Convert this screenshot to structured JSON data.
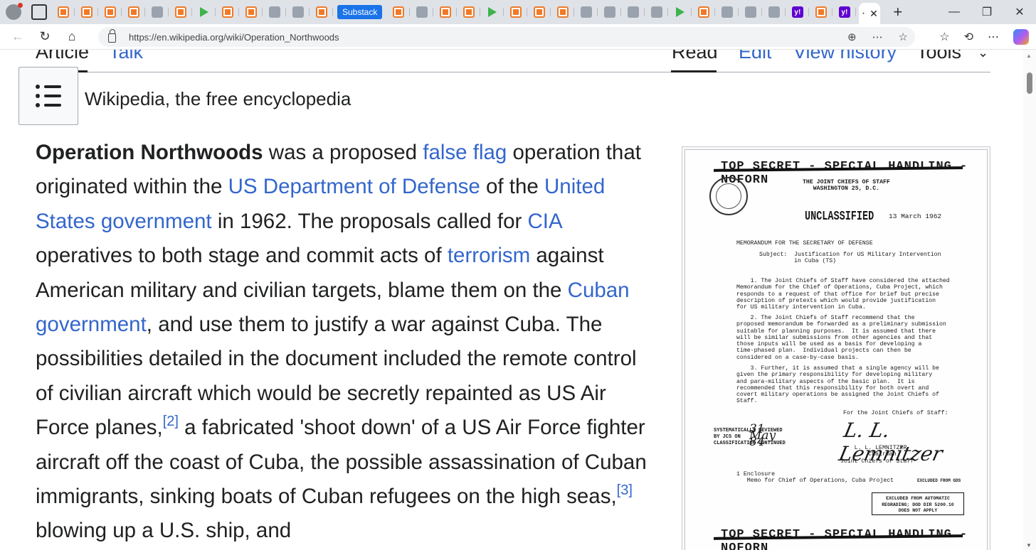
{
  "browser": {
    "active_tab_title": "·",
    "substack_tab_label": "Substack",
    "url": "https://en.wikipedia.org/wiki/Operation_Northwoods",
    "favicon_count": 34
  },
  "wiki": {
    "tabs": {
      "article": "Article",
      "talk": "Talk",
      "read": "Read",
      "edit": "Edit",
      "history": "View history",
      "tools": "Tools"
    },
    "tagline": "Wikipedia, the free encyclopedia",
    "lead": {
      "title": "Operation Northwoods",
      "s1": " was a proposed ",
      "l_false_flag": "false flag",
      "s2": " operation that originated within the ",
      "l_dod": "US Department of Defense",
      "s3": " of the ",
      "l_usgov": "United States government",
      "s4": " in 1962. The proposals called for ",
      "l_cia": "CIA",
      "s5": " operatives to both stage and commit acts of ",
      "l_terrorism": "terrorism",
      "s6": " against American military and civilian targets, blame them on the ",
      "l_cuban_gov": "Cuban government",
      "s7": ", and use them to justify a war against Cuba. The possibilities detailed in the document included the remote control of civilian aircraft which would be secretly repainted as US Air Force planes,",
      "ref2": "[2]",
      "s8": " a fabricated 'shoot down' of a US Air Force fighter aircraft off the coast of Cuba, the possible assassination of Cuban immigrants, sinking boats of Cuban refugees on the high seas,",
      "ref3": "[3]",
      "s9": " blowing up a U.S. ship, and"
    }
  },
  "document": {
    "top_secret": "TOP SECRET - SPECIAL HANDLING - NOFORN",
    "header": "THE JOINT CHIEFS OF STAFF\nWASHINGTON 25, D.C.",
    "unclassified": "UNCLASSIFIED",
    "date": "13 March 1962",
    "memo_to": "MEMORANDUM FOR THE SECRETARY OF DEFENSE",
    "subject": "Subject:  Justification for US Military Intervention\n          in Cuba (TS)",
    "para1": "    1. The Joint Chiefs of Staff have considered the attached\nMemorandum for the Chief of Operations, Cuba Project, which\nresponds to a request of that office for brief but precise\ndescription of pretexts which would provide justification\nfor US military intervention in Cuba.",
    "para2": "    2. The Joint Chiefs of Staff recommend that the\nproposed memorandum be forwarded as a preliminary submission\nsuitable for planning purposes.  It is assumed that there\nwill be similar submissions from other agencies and that\nthose inputs will be used as a basis for developing a\ntime-phased plan.  Individual projects can then be\nconsidered on a case-by-case basis.",
    "para3": "    3. Further, it is assumed that a single agency will be\ngiven the primary responsibility for developing military\nand para-military aspects of the basic plan.  It is\nrecommended that this responsibility for both overt and\ncovert military operations be assigned the Joint Chiefs of\nStaff.",
    "for_jcs": "For the Joint Chiefs of Staff:",
    "review_stamp": "SYSTEMATICALLY REVIEWED\nBY JCS ON\nCLASSIFICATION CONTINUED",
    "review_date": "31 May 84",
    "signature": "L. L. Lemnitzer",
    "signer": "    L. L. LEMNITZER\n        Chairman\nJoint Chiefs of Staff",
    "enclosure": "1 Enclosure\n   Memo for Chief of Operations, Cuba Project",
    "excluded": "EXCLUDED FROM GDS",
    "box": "EXCLUDED FROM AUTOMATIC\nREGRADING; DOD DIR 5200.10\nDOES NOT APPLY"
  }
}
